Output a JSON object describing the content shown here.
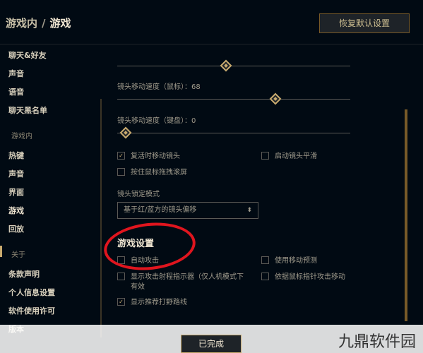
{
  "header": {
    "breadcrumb_parent": "游戏内",
    "breadcrumb_sep": "/",
    "breadcrumb_current": "游戏",
    "restore_button": "恢复默认设置"
  },
  "sidebar": {
    "items": [
      "聊天&好友",
      "声音",
      "语音",
      "聊天黑名单"
    ],
    "section_ingame": "游戏内",
    "ingame_items": [
      "热键",
      "声音",
      "界面",
      "游戏",
      "回放"
    ],
    "section_about": "关于",
    "about_items": [
      "条款声明",
      "个人信息设置",
      "软件使用许可",
      "版本"
    ]
  },
  "camera": {
    "mouse_speed_label": "镜头移动速度（鼠标）：68",
    "mouse_speed_value": 68,
    "keyboard_speed_label": "镜头移动速度（键盘）：0",
    "keyboard_speed_value": 0,
    "top_slider_value": 57,
    "options": [
      {
        "label": "复活时移动镜头",
        "checked": true
      },
      {
        "label": "启动镜头平滑",
        "checked": false
      },
      {
        "label": "按住鼠标拖拽滚屏",
        "checked": false
      }
    ],
    "lock_mode_label": "镜头锁定模式",
    "lock_mode_value": "基于红/蓝方的镜头偏移"
  },
  "game_settings": {
    "title": "游戏设置",
    "options": [
      {
        "label": "自动攻击",
        "checked": false
      },
      {
        "label": "使用移动预测",
        "checked": false
      },
      {
        "label": "显示攻击射程指示器（仅人机模式下",
        "label2": "有效",
        "checked": false
      },
      {
        "label": "依据鼠标指针攻击移动",
        "checked": false
      },
      {
        "label": "显示推荐打野路线",
        "checked": true
      }
    ]
  },
  "footer": {
    "done_button": "已完成"
  },
  "watermark": "九鼎软件园",
  "colors": {
    "background": "#010a13",
    "gold": "#c8aa6e",
    "annotation_red": "#e0151e"
  }
}
